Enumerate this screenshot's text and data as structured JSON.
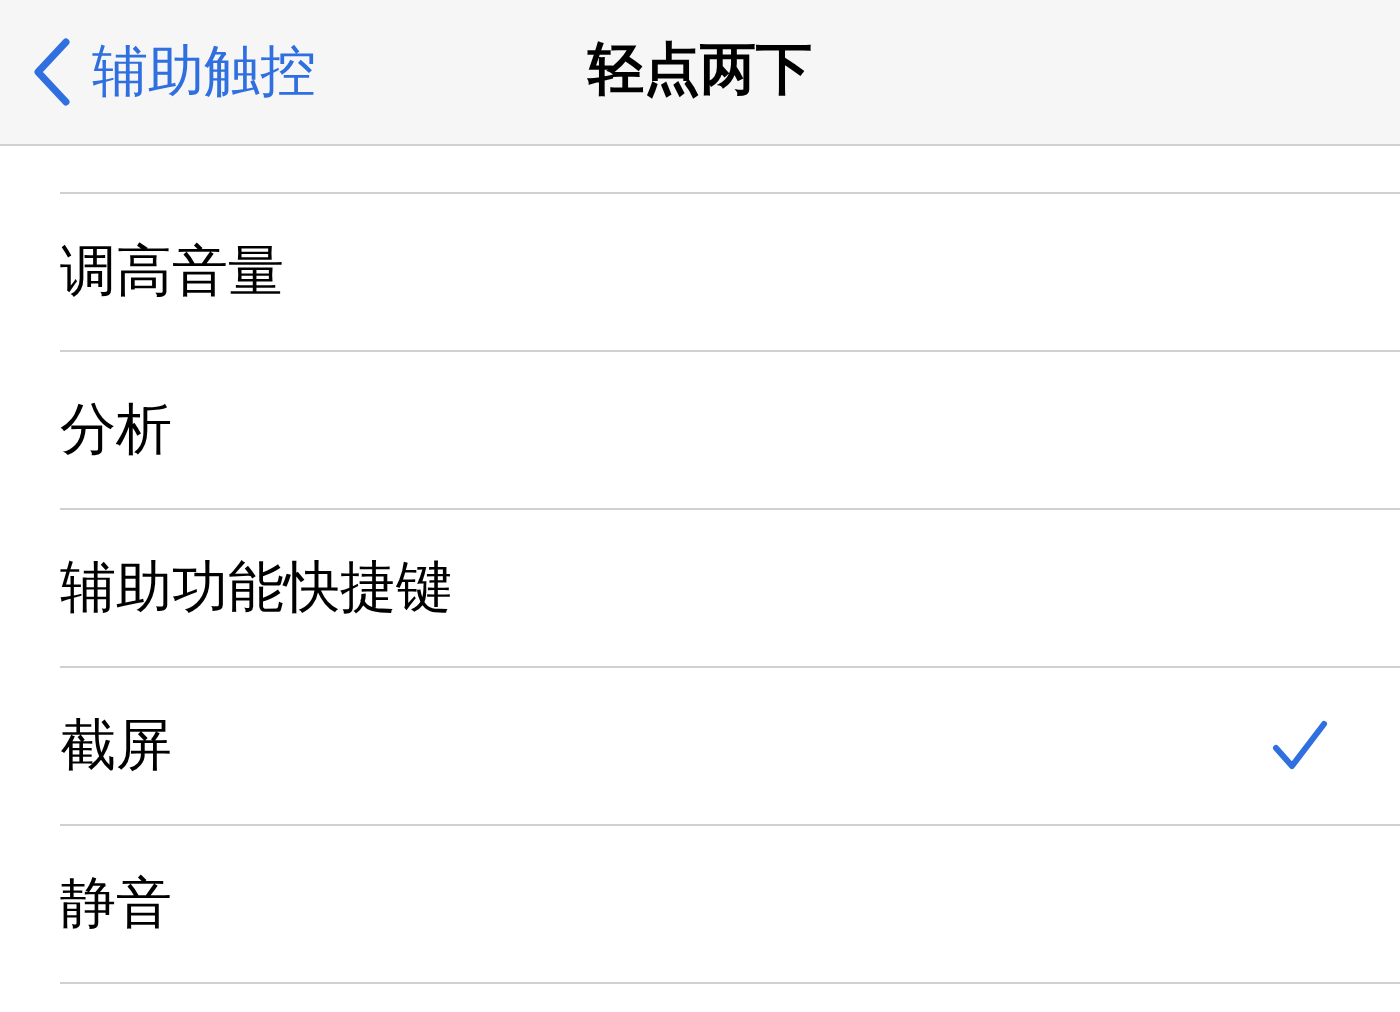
{
  "nav": {
    "back": "辅助触控",
    "title": "轻点两下"
  },
  "options": [
    {
      "label": "调高音量",
      "selected": false
    },
    {
      "label": "分析",
      "selected": false
    },
    {
      "label": "辅助功能快捷键",
      "selected": false
    },
    {
      "label": "截屏",
      "selected": true
    },
    {
      "label": "静音",
      "selected": false
    }
  ]
}
